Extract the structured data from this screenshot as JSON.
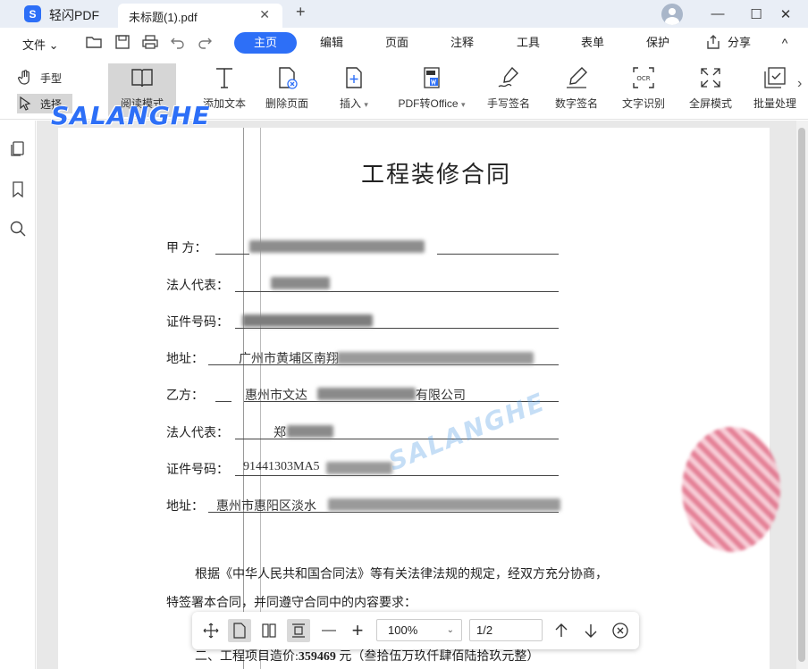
{
  "titlebar": {
    "app_name": "轻闪PDF",
    "app_logo": "S",
    "doc_tab": "未标题(1).pdf",
    "tab_close": "✕",
    "new_tab": "+",
    "minimize": "—",
    "maximize": "☐",
    "close": "✕"
  },
  "menubar": {
    "file_label": "文件 ⌄",
    "tabs": [
      "主页",
      "编辑",
      "页面",
      "注释",
      "工具",
      "表单",
      "保护"
    ],
    "active_tab": "主页",
    "share": "分享",
    "collapse": "^"
  },
  "toolbar": {
    "hand": "手型",
    "select": "选择",
    "read_mode": "阅读模式",
    "add_text": "添加文本",
    "delete_page": "删除页面",
    "insert": "插入",
    "pdf_to_office": "PDF转Office",
    "handwrite_sign": "手写签名",
    "digital_sign": "数字签名",
    "ocr": "文字识别",
    "fullscreen": "全屏模式",
    "batch": "批量处理",
    "more": "›"
  },
  "watermark": "SALANGHE",
  "document": {
    "title": "工程装修合同",
    "fields": [
      {
        "label": "甲 方：",
        "value": ""
      },
      {
        "label": "法人代表：",
        "value": ""
      },
      {
        "label": "证件号码：",
        "value": ""
      },
      {
        "label": "地址：",
        "value": "广州市黄埔区南翔"
      },
      {
        "label": "乙方：",
        "value": "惠州市文达",
        "suffix": "有限公司"
      },
      {
        "label": "法人代表：",
        "value": "郑"
      },
      {
        "label": "证件号码：",
        "value": "91441303MA5"
      },
      {
        "label": "地址：",
        "value": "惠州市惠阳区淡水"
      }
    ],
    "para1": "根据《中华人民共和国合同法》等有关法律法规的规定，经双方充分协商，",
    "para2": "特签署本合同，并同遵守合同中的内容要求：",
    "para3_prefix": "二、工程项目造价:",
    "para3_amount": "359469",
    "para3_suffix": "元（叁拾伍万玖仟肆佰陆拾玖元整）"
  },
  "floatbar": {
    "zoom": "100%",
    "page": "1/2",
    "zoom_out": "—",
    "zoom_in": "+"
  }
}
